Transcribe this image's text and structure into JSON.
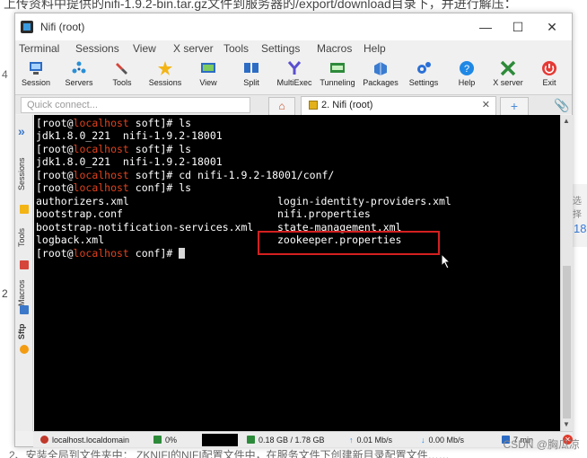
{
  "background": {
    "top_text": "上传资料中提供的nifi-1.9.2-bin.tar.gz文件到服务器的/export/download目录下，并进行解压：",
    "left_mark": "4",
    "left_mark2": "2",
    "right_text1": "选择",
    "right_text2": "18",
    "bottom_text": "2、安装全局到文件夹中：  ZKNIFI的NIFI配置文件中，在服务文件下创建新目录配置文件……",
    "watermark": "CSDN @胸瓜凉"
  },
  "window": {
    "title": "Nifi (root)",
    "minimize": "—",
    "maximize": "☐",
    "close": "✕"
  },
  "menu": [
    "Terminal",
    "Sessions",
    "View",
    "X server",
    "Tools",
    "Settings",
    "Macros",
    "Help"
  ],
  "toolbar": [
    {
      "label": "Session",
      "icon": "session-icon",
      "color": "#2d6cc4"
    },
    {
      "label": "Servers",
      "icon": "servers-icon",
      "color": "#2a8fd6"
    },
    {
      "label": "Tools",
      "icon": "tools-icon",
      "color": "#d6453a"
    },
    {
      "label": "Sessions",
      "icon": "star-icon",
      "color": "#f3b416"
    },
    {
      "label": "View",
      "icon": "view-icon",
      "color": "#2d6cc4"
    },
    {
      "label": "Split",
      "icon": "split-icon",
      "color": "#2d6cc4"
    },
    {
      "label": "MultiExec",
      "icon": "multiexec-icon",
      "color": "#5a4fcf"
    },
    {
      "label": "Tunneling",
      "icon": "tunneling-icon",
      "color": "#2d8a3a"
    },
    {
      "label": "Packages",
      "icon": "packages-icon",
      "color": "#3b7cd1"
    },
    {
      "label": "Settings",
      "icon": "settings-icon",
      "color": "#2a6fd6"
    },
    {
      "label": "Help",
      "icon": "help-icon",
      "color": "#1e88e5"
    },
    {
      "label": "X server",
      "icon": "xserver-icon",
      "color": "#2d8a3a"
    },
    {
      "label": "Exit",
      "icon": "exit-icon",
      "color": "#e53935"
    }
  ],
  "tabs": {
    "quick_connect_placeholder": "Quick connect...",
    "home_icon": "⌂",
    "session_tab": "2. Nifi (root)",
    "session_close": "✕",
    "new_tab": "+"
  },
  "sidebar": {
    "chevron": "»",
    "labels": [
      "Sessions",
      "Tools",
      "Macros",
      "Sftp"
    ]
  },
  "terminal": {
    "lines": [
      {
        "user": "[root@",
        "host": "localhost",
        "rest": " soft]# ls"
      },
      {
        "dir": "jdk1.8.0_221  nifi-1.9.2-18001"
      },
      {
        "user": "[root@",
        "host": "localhost",
        "rest": " soft]# ls"
      },
      {
        "dir": "jdk1.8.0_221  nifi-1.9.2-18001"
      },
      {
        "user": "[root@",
        "host": "localhost",
        "rest": " soft]# cd nifi-1.9.2-18001/conf/"
      },
      {
        "user": "[root@",
        "host": "localhost",
        "rest": " conf]# ls"
      }
    ],
    "files_col1": [
      "authorizers.xml",
      "bootstrap.conf",
      "bootstrap-notification-services.xml",
      "logback.xml"
    ],
    "files_col2": [
      "login-identity-providers.xml",
      "nifi.properties",
      "state-management.xml",
      "zookeeper.properties"
    ],
    "prompt_user": "[root@",
    "prompt_host": "localhost",
    "prompt_rest": " conf]# "
  },
  "statusbar": {
    "host": "localhost.localdomain",
    "cpu": "0%",
    "memory": "0.18 GB / 1.78 GB",
    "upload": "0.01 Mb/s",
    "download": "0.00 Mb/s",
    "uptime": "7 min",
    "close_icon": "✕"
  }
}
